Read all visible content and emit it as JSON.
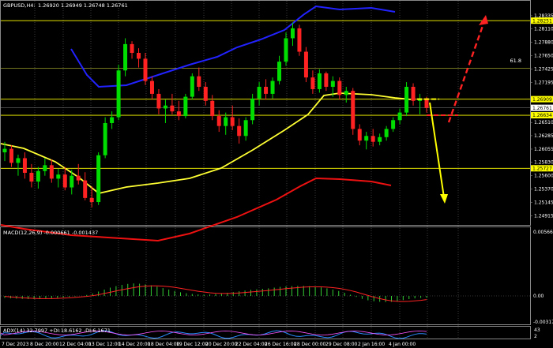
{
  "header": {
    "symbol": "GBPUSD,H4:",
    "ohlc": "1.26920 1.26949 1.26748 1.26761"
  },
  "fib_label": "61.8",
  "price_axis": [
    {
      "label": "1.28335",
      "price": 1.28335
    },
    {
      "label": "1.28110",
      "price": 1.2811
    },
    {
      "label": "1.27880",
      "price": 1.2788
    },
    {
      "label": "1.27650",
      "price": 1.2765
    },
    {
      "label": "1.27425",
      "price": 1.27425
    },
    {
      "label": "1.27195",
      "price": 1.27195
    },
    {
      "label": "1.26510",
      "price": 1.2651
    },
    {
      "label": "1.26285",
      "price": 1.26285
    },
    {
      "label": "1.26055",
      "price": 1.26055
    },
    {
      "label": "1.25830",
      "price": 1.2583
    },
    {
      "label": "1.25600",
      "price": 1.256
    },
    {
      "label": "1.25370",
      "price": 1.2537
    },
    {
      "label": "1.25145",
      "price": 1.25145
    },
    {
      "label": "1.24915",
      "price": 1.24915
    }
  ],
  "highlight_levels": [
    {
      "label": "1.28251",
      "price": 1.28251,
      "bg": "#ffff00"
    },
    {
      "label": "1.26909",
      "price": 1.26909,
      "bg": "#ffff00"
    },
    {
      "label": "1.26761",
      "price": 1.26761,
      "bg": "#ffffff"
    },
    {
      "label": "1.26634",
      "price": 1.26634,
      "bg": "#ffff00"
    },
    {
      "label": "1.25727",
      "price": 1.25727,
      "bg": "#ffff00"
    }
  ],
  "macd": {
    "label": "MACD(12,26,9) -0.000661 -0.001437",
    "axis": [
      "0.005665",
      "0.00",
      "-0.003171"
    ],
    "histogram": [
      -0.0008,
      -0.001,
      -0.0011,
      -0.0012,
      -0.0013,
      -0.0013,
      -0.0012,
      -0.0011,
      -0.001,
      -0.0008,
      -0.0006,
      -0.0004,
      -0.0002,
      0.0,
      0.0004,
      0.001,
      0.0018,
      0.0026,
      0.0034,
      0.004,
      0.0045,
      0.0049,
      0.0051,
      0.005,
      0.0047,
      0.0043,
      0.0038,
      0.0032,
      0.0026,
      0.002,
      0.0015,
      0.0011,
      0.0008,
      0.0006,
      0.0005,
      0.0006,
      0.0008,
      0.001,
      0.0013,
      0.0016,
      0.0019,
      0.0022,
      0.0025,
      0.0027,
      0.0029,
      0.0031,
      0.0034,
      0.0037,
      0.0039,
      0.004,
      0.0041,
      0.0041,
      0.004,
      0.0038,
      0.0035,
      0.0031,
      0.0026,
      0.002,
      0.0013,
      0.0005,
      -0.0004,
      -0.0012,
      -0.0018,
      -0.0022,
      -0.0024,
      -0.0025,
      -0.0024,
      -0.0021,
      -0.0017,
      -0.0013,
      -0.001,
      -0.0008,
      -0.0007
    ],
    "signal": [
      -0.0002,
      -0.0004,
      -0.0006,
      -0.0008,
      -0.0009,
      -0.001,
      -0.0011,
      -0.0011,
      -0.0011,
      -0.001,
      -0.0009,
      -0.0008,
      -0.0006,
      -0.0004,
      -0.0002,
      0.0001,
      0.0005,
      0.001,
      0.0015,
      0.002,
      0.0025,
      0.003,
      0.0034,
      0.0038,
      0.004,
      0.0041,
      0.0041,
      0.004,
      0.0038,
      0.0035,
      0.0031,
      0.0027,
      0.0023,
      0.0019,
      0.0016,
      0.0013,
      0.0011,
      0.001,
      0.001,
      0.0011,
      0.0012,
      0.0014,
      0.0016,
      0.0018,
      0.002,
      0.0022,
      0.0025,
      0.0027,
      0.003,
      0.0032,
      0.0034,
      0.0036,
      0.0037,
      0.0037,
      0.0037,
      0.0036,
      0.0034,
      0.0031,
      0.0027,
      0.0022,
      0.0016,
      0.0009,
      0.0002,
      -0.0005,
      -0.0011,
      -0.0016,
      -0.002,
      -0.0022,
      -0.0023,
      -0.0022,
      -0.002,
      -0.0018,
      -0.0015
    ]
  },
  "adx": {
    "label": "ADX(14) 32.7997 +DI:18.6162 -DI:6.1671",
    "axis": [
      "43",
      "2"
    ]
  },
  "time_axis": [
    "7 Dec 2023",
    "8 Dec 20:00",
    "12 Dec 04:00",
    "13 Dec 12:00",
    "14 Dec 20:00",
    "18 Dec 04:00",
    "19 Dec 12:00",
    "20 Dec 20:00",
    "22 Dec 04:00",
    "26 Dec 16:00",
    "28 Dec 00:00",
    "29 Dec 08:00",
    "2 Jan 16:00",
    "4 Jan 00:00"
  ],
  "chart_data": {
    "type": "candlestick",
    "symbol": "GBPUSD",
    "timeframe": "H4",
    "candles": [
      {
        "o": 1.26,
        "h": 1.2618,
        "l": 1.2585,
        "c": 1.2606
      },
      {
        "o": 1.2606,
        "h": 1.2612,
        "l": 1.2575,
        "c": 1.2582
      },
      {
        "o": 1.2582,
        "h": 1.2596,
        "l": 1.256,
        "c": 1.259
      },
      {
        "o": 1.259,
        "h": 1.26,
        "l": 1.2555,
        "c": 1.2565
      },
      {
        "o": 1.2565,
        "h": 1.258,
        "l": 1.254,
        "c": 1.255
      },
      {
        "o": 1.255,
        "h": 1.2575,
        "l": 1.2538,
        "c": 1.2568
      },
      {
        "o": 1.2568,
        "h": 1.259,
        "l": 1.256,
        "c": 1.2578
      },
      {
        "o": 1.2578,
        "h": 1.2588,
        "l": 1.2548,
        "c": 1.2555
      },
      {
        "o": 1.2555,
        "h": 1.2572,
        "l": 1.254,
        "c": 1.2562
      },
      {
        "o": 1.2562,
        "h": 1.2575,
        "l": 1.2535,
        "c": 1.254
      },
      {
        "o": 1.254,
        "h": 1.257,
        "l": 1.2528,
        "c": 1.256
      },
      {
        "o": 1.256,
        "h": 1.258,
        "l": 1.2545,
        "c": 1.2552
      },
      {
        "o": 1.2552,
        "h": 1.2566,
        "l": 1.2518,
        "c": 1.2522
      },
      {
        "o": 1.2522,
        "h": 1.2542,
        "l": 1.2506,
        "c": 1.2515
      },
      {
        "o": 1.2515,
        "h": 1.26,
        "l": 1.251,
        "c": 1.2595
      },
      {
        "o": 1.2595,
        "h": 1.266,
        "l": 1.259,
        "c": 1.265
      },
      {
        "o": 1.265,
        "h": 1.267,
        "l": 1.264,
        "c": 1.266
      },
      {
        "o": 1.266,
        "h": 1.275,
        "l": 1.2655,
        "c": 1.274
      },
      {
        "o": 1.274,
        "h": 1.2795,
        "l": 1.273,
        "c": 1.2785
      },
      {
        "o": 1.2785,
        "h": 1.279,
        "l": 1.276,
        "c": 1.277
      },
      {
        "o": 1.277,
        "h": 1.2778,
        "l": 1.2745,
        "c": 1.276
      },
      {
        "o": 1.276,
        "h": 1.277,
        "l": 1.2715,
        "c": 1.2722
      },
      {
        "o": 1.2722,
        "h": 1.273,
        "l": 1.269,
        "c": 1.27
      },
      {
        "o": 1.27,
        "h": 1.2708,
        "l": 1.2665,
        "c": 1.2675
      },
      {
        "o": 1.2675,
        "h": 1.269,
        "l": 1.265,
        "c": 1.268
      },
      {
        "o": 1.268,
        "h": 1.27,
        "l": 1.2665,
        "c": 1.267
      },
      {
        "o": 1.267,
        "h": 1.2688,
        "l": 1.2655,
        "c": 1.2662
      },
      {
        "o": 1.2662,
        "h": 1.27,
        "l": 1.2658,
        "c": 1.2695
      },
      {
        "o": 1.2695,
        "h": 1.2735,
        "l": 1.269,
        "c": 1.273
      },
      {
        "o": 1.273,
        "h": 1.2745,
        "l": 1.2705,
        "c": 1.2712
      },
      {
        "o": 1.2712,
        "h": 1.272,
        "l": 1.268,
        "c": 1.2688
      },
      {
        "o": 1.2688,
        "h": 1.2698,
        "l": 1.2655,
        "c": 1.2662
      },
      {
        "o": 1.2662,
        "h": 1.2672,
        "l": 1.2635,
        "c": 1.2645
      },
      {
        "o": 1.2645,
        "h": 1.2668,
        "l": 1.263,
        "c": 1.266
      },
      {
        "o": 1.266,
        "h": 1.268,
        "l": 1.2638,
        "c": 1.2645
      },
      {
        "o": 1.2645,
        "h": 1.2658,
        "l": 1.2615,
        "c": 1.2628
      },
      {
        "o": 1.2628,
        "h": 1.266,
        "l": 1.262,
        "c": 1.2655
      },
      {
        "o": 1.2655,
        "h": 1.27,
        "l": 1.2648,
        "c": 1.2692
      },
      {
        "o": 1.2692,
        "h": 1.272,
        "l": 1.268,
        "c": 1.2712
      },
      {
        "o": 1.2712,
        "h": 1.2725,
        "l": 1.269,
        "c": 1.27
      },
      {
        "o": 1.27,
        "h": 1.2728,
        "l": 1.2692,
        "c": 1.2722
      },
      {
        "o": 1.2722,
        "h": 1.2765,
        "l": 1.2716,
        "c": 1.2755
      },
      {
        "o": 1.2755,
        "h": 1.2805,
        "l": 1.2748,
        "c": 1.2795
      },
      {
        "o": 1.2795,
        "h": 1.2822,
        "l": 1.2782,
        "c": 1.2812
      },
      {
        "o": 1.2812,
        "h": 1.2818,
        "l": 1.2765,
        "c": 1.2772
      },
      {
        "o": 1.2772,
        "h": 1.278,
        "l": 1.272,
        "c": 1.2728
      },
      {
        "o": 1.2728,
        "h": 1.274,
        "l": 1.27,
        "c": 1.2708
      },
      {
        "o": 1.2708,
        "h": 1.2742,
        "l": 1.2702,
        "c": 1.2735
      },
      {
        "o": 1.2735,
        "h": 1.2738,
        "l": 1.2705,
        "c": 1.2712
      },
      {
        "o": 1.2712,
        "h": 1.273,
        "l": 1.2695,
        "c": 1.2722
      },
      {
        "o": 1.2722,
        "h": 1.2728,
        "l": 1.269,
        "c": 1.2698
      },
      {
        "o": 1.2698,
        "h": 1.2712,
        "l": 1.2685,
        "c": 1.2705
      },
      {
        "o": 1.2705,
        "h": 1.271,
        "l": 1.263,
        "c": 1.264
      },
      {
        "o": 1.264,
        "h": 1.2648,
        "l": 1.2612,
        "c": 1.262
      },
      {
        "o": 1.262,
        "h": 1.2635,
        "l": 1.2605,
        "c": 1.2628
      },
      {
        "o": 1.2628,
        "h": 1.264,
        "l": 1.261,
        "c": 1.2618
      },
      {
        "o": 1.2618,
        "h": 1.2632,
        "l": 1.2612,
        "c": 1.2626
      },
      {
        "o": 1.2626,
        "h": 1.2645,
        "l": 1.262,
        "c": 1.264
      },
      {
        "o": 1.264,
        "h": 1.266,
        "l": 1.2635,
        "c": 1.2655
      },
      {
        "o": 1.2655,
        "h": 1.2675,
        "l": 1.2648,
        "c": 1.2668
      },
      {
        "o": 1.2668,
        "h": 1.272,
        "l": 1.2662,
        "c": 1.2712
      },
      {
        "o": 1.2712,
        "h": 1.2718,
        "l": 1.268,
        "c": 1.2688
      },
      {
        "o": 1.2688,
        "h": 1.27,
        "l": 1.2665,
        "c": 1.2692
      },
      {
        "o": 1.2692,
        "h": 1.2695,
        "l": 1.2668,
        "c": 1.2676
      }
    ],
    "indicators": {
      "upper_band_color": "#2222ff",
      "middle_ma_color": "#ffff33",
      "lower_band_color": "#ee1111"
    },
    "y_range": [
      1.248,
      1.2855
    ]
  },
  "colors": {
    "bull": "#00dd00",
    "bear": "#ff2222",
    "grid": "#666666",
    "yellow_line": "#ffff00",
    "arrow_yellow": "#ffff00",
    "arrow_red": "#ff2222",
    "macd_hist": "#33cc33",
    "macd_signal": "#ff2222",
    "adx_line": "#2a8bff"
  }
}
